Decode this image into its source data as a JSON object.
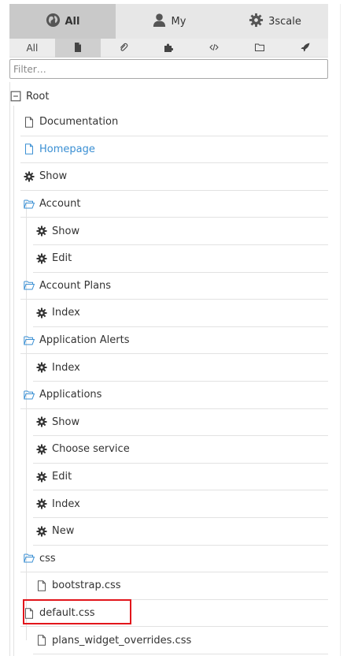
{
  "tabs": [
    {
      "label": "All",
      "icon": "globe-icon",
      "active": true
    },
    {
      "label": "My",
      "icon": "user-icon",
      "active": false
    },
    {
      "label": "3scale",
      "icon": "gear-icon",
      "active": false
    }
  ],
  "filters": [
    {
      "label": "All",
      "icon": null,
      "active": false
    },
    {
      "label": "",
      "icon": "page-icon",
      "active": true
    },
    {
      "label": "",
      "icon": "paperclip-icon",
      "active": false
    },
    {
      "label": "",
      "icon": "puzzle-icon",
      "active": false
    },
    {
      "label": "",
      "icon": "code-icon",
      "active": false
    },
    {
      "label": "",
      "icon": "folder-icon",
      "active": false
    },
    {
      "label": "",
      "icon": "rocket-icon",
      "active": false
    }
  ],
  "search": {
    "placeholder": "Filter…",
    "value": ""
  },
  "tree": {
    "root_label": "Root",
    "root_icon": "minus-square-icon",
    "items": [
      {
        "label": "Documentation",
        "icon": "file-icon",
        "depth": 1,
        "link": false
      },
      {
        "label": "Homepage",
        "icon": "file-icon",
        "depth": 1,
        "link": true
      },
      {
        "label": "Show",
        "icon": "cog-icon",
        "depth": 1,
        "link": false
      },
      {
        "label": "Account",
        "icon": "folder-open-icon",
        "depth": 1,
        "link": false
      },
      {
        "label": "Show",
        "icon": "cog-icon",
        "depth": 2,
        "link": false
      },
      {
        "label": "Edit",
        "icon": "cog-icon",
        "depth": 2,
        "link": false
      },
      {
        "label": "Account Plans",
        "icon": "folder-open-icon",
        "depth": 1,
        "link": false
      },
      {
        "label": "Index",
        "icon": "cog-icon",
        "depth": 2,
        "link": false
      },
      {
        "label": "Application Alerts",
        "icon": "folder-open-icon",
        "depth": 1,
        "link": false
      },
      {
        "label": "Index",
        "icon": "cog-icon",
        "depth": 2,
        "link": false
      },
      {
        "label": "Applications",
        "icon": "folder-open-icon",
        "depth": 1,
        "link": false
      },
      {
        "label": "Show",
        "icon": "cog-icon",
        "depth": 2,
        "link": false
      },
      {
        "label": "Choose service",
        "icon": "cog-icon",
        "depth": 2,
        "link": false
      },
      {
        "label": "Edit",
        "icon": "cog-icon",
        "depth": 2,
        "link": false
      },
      {
        "label": "Index",
        "icon": "cog-icon",
        "depth": 2,
        "link": false
      },
      {
        "label": "New",
        "icon": "cog-icon",
        "depth": 2,
        "link": false
      },
      {
        "label": "css",
        "icon": "folder-open-icon",
        "depth": 1,
        "link": false
      },
      {
        "label": "bootstrap.css",
        "icon": "file-icon",
        "depth": 2,
        "link": false
      },
      {
        "label": "default.css",
        "icon": "file-icon",
        "depth": 1,
        "link": false,
        "highlighted": true
      },
      {
        "label": "plans_widget_overrides.css",
        "icon": "file-icon",
        "depth": 2,
        "link": false
      }
    ]
  },
  "colors": {
    "link": "#3a8fd3",
    "highlight": "#e2151b",
    "active_tab": "#c9c9c9"
  }
}
